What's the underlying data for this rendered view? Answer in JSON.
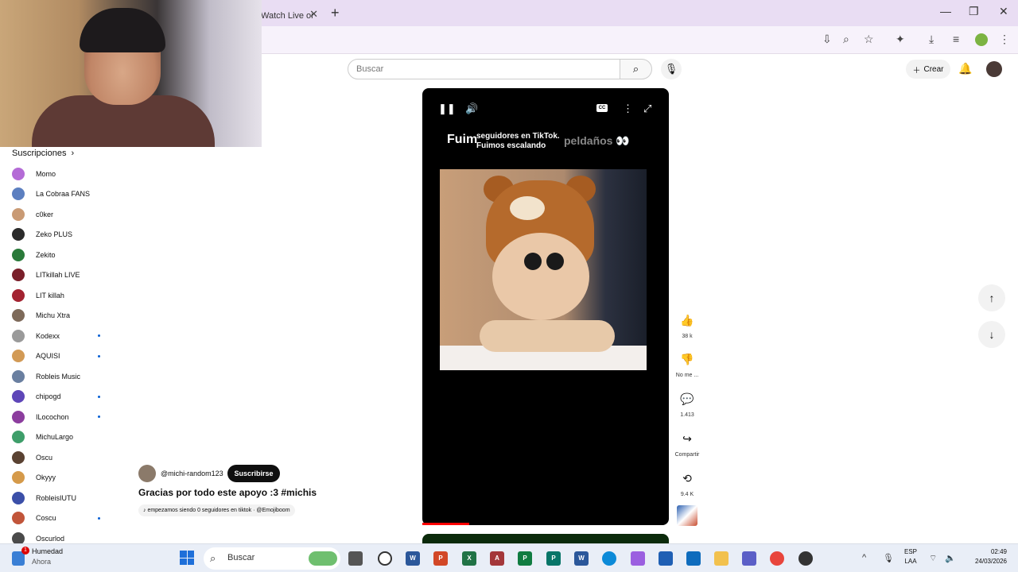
{
  "browser": {
    "tab_title": "Watch Live or",
    "tab_close": "✕",
    "new_tab": "+",
    "window_controls": {
      "minimize": "—",
      "maximize": "❐",
      "close": "✕"
    }
  },
  "header": {
    "search_placeholder": "Buscar",
    "create_label": "Crear"
  },
  "sidebar": {
    "subscriptions_label": "Suscripciones",
    "items": [
      {
        "label": "Momo",
        "color": "#b46bd6",
        "dot": false
      },
      {
        "label": "La Cobraa FANS",
        "color": "#5c7fc0",
        "dot": false
      },
      {
        "label": "c0ker",
        "color": "#c99a74",
        "dot": false
      },
      {
        "label": "Zeko PLUS",
        "color": "#2b2b2b",
        "dot": false
      },
      {
        "label": "Zekito",
        "color": "#2a7a3a",
        "dot": false
      },
      {
        "label": "LITkillah LIVE",
        "color": "#7a1f2a",
        "dot": false
      },
      {
        "label": "LIT killah",
        "color": "#a32331",
        "dot": false
      },
      {
        "label": "Michu Xtra",
        "color": "#7e6a5a",
        "dot": false
      },
      {
        "label": "Kodexx",
        "color": "#9a9a9a",
        "dot": true
      },
      {
        "label": "AQUISI",
        "color": "#d29a55",
        "dot": true
      },
      {
        "label": "Robleis Music",
        "color": "#6a7fa0",
        "dot": false
      },
      {
        "label": "chipogd",
        "color": "#5e46b8",
        "dot": true
      },
      {
        "label": "ILocochon",
        "color": "#8c3d9e",
        "dot": true
      },
      {
        "label": "MichuLargo",
        "color": "#3e9e6a",
        "dot": false
      },
      {
        "label": "Oscu",
        "color": "#5a4232",
        "dot": false
      },
      {
        "label": "Okyyy",
        "color": "#d59a4a",
        "dot": false
      },
      {
        "label": "RobleisIUTU",
        "color": "#3b4fa8",
        "dot": false
      },
      {
        "label": "Coscu",
        "color": "#c1553a",
        "dot": true
      },
      {
        "label": "Oscurlod",
        "color": "#4a4a4a",
        "dot": false
      }
    ]
  },
  "player": {
    "overlay_left": "Fuim",
    "overlay_mid_1": "seguidores en TikTok.",
    "overlay_mid_2": "Fuimos escalando",
    "overlay_right": "peldaños 👀",
    "progress_fraction": 0.19
  },
  "actions": [
    {
      "name": "like",
      "icon": "👍",
      "label": "38 k"
    },
    {
      "name": "dislike",
      "icon": "👎",
      "label": "No me ..."
    },
    {
      "name": "comments",
      "icon": "💬",
      "label": "1.413"
    },
    {
      "name": "share",
      "icon": "↪",
      "label": "Compartir"
    },
    {
      "name": "remix",
      "icon": "⟲",
      "label": "9.4 K"
    }
  ],
  "video": {
    "channel": "@michi-random123",
    "subscribe_label": "Suscribirse",
    "title": "Gracias por todo este apoyo :3 #michis",
    "sound": "♪ empezamos siendo 0 seguidores en tiktok · @Emojiboom"
  },
  "taskbar": {
    "weather_badge": "1",
    "weather_title": "Humedad",
    "weather_sub": "Ahora",
    "search_label": "Buscar",
    "lang_1": "ESP",
    "lang_2": "LAA",
    "time": "02:49",
    "date": "24/03/2026"
  },
  "colors": {
    "accent": "#065fd4",
    "progress": "#ff0000",
    "titlebar": "#e9ddf3"
  }
}
